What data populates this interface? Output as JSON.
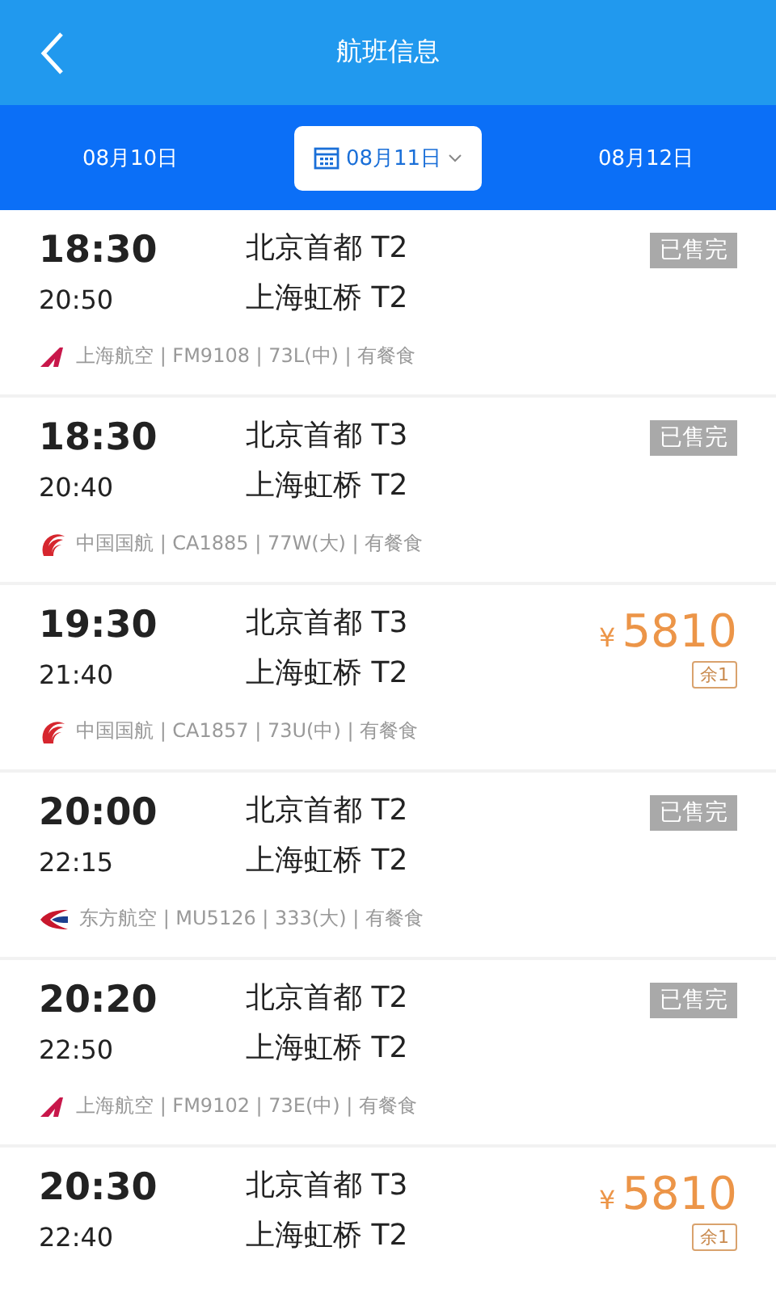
{
  "header": {
    "title": "航班信息"
  },
  "dates": [
    {
      "label": "08月10日",
      "selected": false
    },
    {
      "label": "08月11日",
      "selected": true
    },
    {
      "label": "08月12日",
      "selected": false
    }
  ],
  "flights": [
    {
      "depart": "18:30",
      "arrive": "20:50",
      "from": "北京首都 T2",
      "to": "上海虹桥 T2",
      "kind": "sold_out",
      "status": "已售完",
      "airline": {
        "kind": "shanghai",
        "info": "上海航空 | FM9108 | 73L(中) | 有餐食"
      }
    },
    {
      "depart": "18:30",
      "arrive": "20:40",
      "from": "北京首都 T3",
      "to": "上海虹桥 T2",
      "kind": "sold_out",
      "status": "已售完",
      "airline": {
        "kind": "airchina",
        "info": "中国国航 | CA1885 | 77W(大) | 有餐食"
      }
    },
    {
      "depart": "19:30",
      "arrive": "21:40",
      "from": "北京首都 T3",
      "to": "上海虹桥 T2",
      "kind": "price",
      "currency": "¥",
      "price": "5810",
      "remaining": "余1",
      "airline": {
        "kind": "airchina",
        "info": "中国国航 | CA1857 | 73U(中) | 有餐食"
      }
    },
    {
      "depart": "20:00",
      "arrive": "22:15",
      "from": "北京首都 T2",
      "to": "上海虹桥 T2",
      "kind": "sold_out",
      "status": "已售完",
      "airline": {
        "kind": "eastern",
        "info": "东方航空 | MU5126 | 333(大) | 有餐食"
      }
    },
    {
      "depart": "20:20",
      "arrive": "22:50",
      "from": "北京首都 T2",
      "to": "上海虹桥 T2",
      "kind": "sold_out",
      "status": "已售完",
      "airline": {
        "kind": "shanghai",
        "info": "上海航空 | FM9102 | 73E(中) | 有餐食"
      }
    },
    {
      "depart": "20:30",
      "arrive": "22:40",
      "from": "北京首都 T3",
      "to": "上海虹桥 T2",
      "kind": "price",
      "currency": "¥",
      "price": "5810",
      "remaining": "余1"
    }
  ]
}
